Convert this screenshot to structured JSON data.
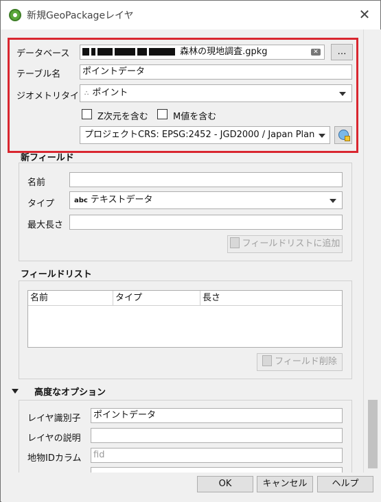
{
  "window": {
    "title": "新規GeoPackageレイヤ"
  },
  "top": {
    "database_label": "データベース",
    "database_value": "森林の現地調査.gpkg",
    "database_browse": "…",
    "table_label": "テーブル名",
    "table_value": "ポイントデータ",
    "geometry_label": "ジオメトリタイプ",
    "geometry_value": "ポイント",
    "z_label": "Z次元を含む",
    "m_label": "M値を含む",
    "crs_value": "プロジェクトCRS: EPSG:2452 - JGD2000 / Japan Plan"
  },
  "new_field": {
    "title": "新フィールド",
    "name_label": "名前",
    "name_value": "",
    "type_label": "タイプ",
    "type_icon_text": "abc",
    "type_value": "テキストデータ",
    "maxlen_label": "最大長さ",
    "maxlen_value": "",
    "add_button": "フィールドリストに追加"
  },
  "field_list": {
    "title": "フィールドリスト",
    "columns": [
      "名前",
      "タイプ",
      "長さ"
    ],
    "delete_button": "フィールド削除"
  },
  "advanced": {
    "title": "高度なオプション",
    "layer_id_label": "レイヤ識別子",
    "layer_id_value": "ポイントデータ",
    "layer_desc_label": "レイヤの説明",
    "layer_desc_value": "",
    "fid_label": "地物IDカラム",
    "fid_placeholder": "fid"
  },
  "footer": {
    "ok": "OK",
    "cancel": "キャンセル",
    "help": "ヘルプ"
  },
  "colors": {
    "highlight": "#d9262f",
    "window_bg": "#f0f0f0"
  }
}
